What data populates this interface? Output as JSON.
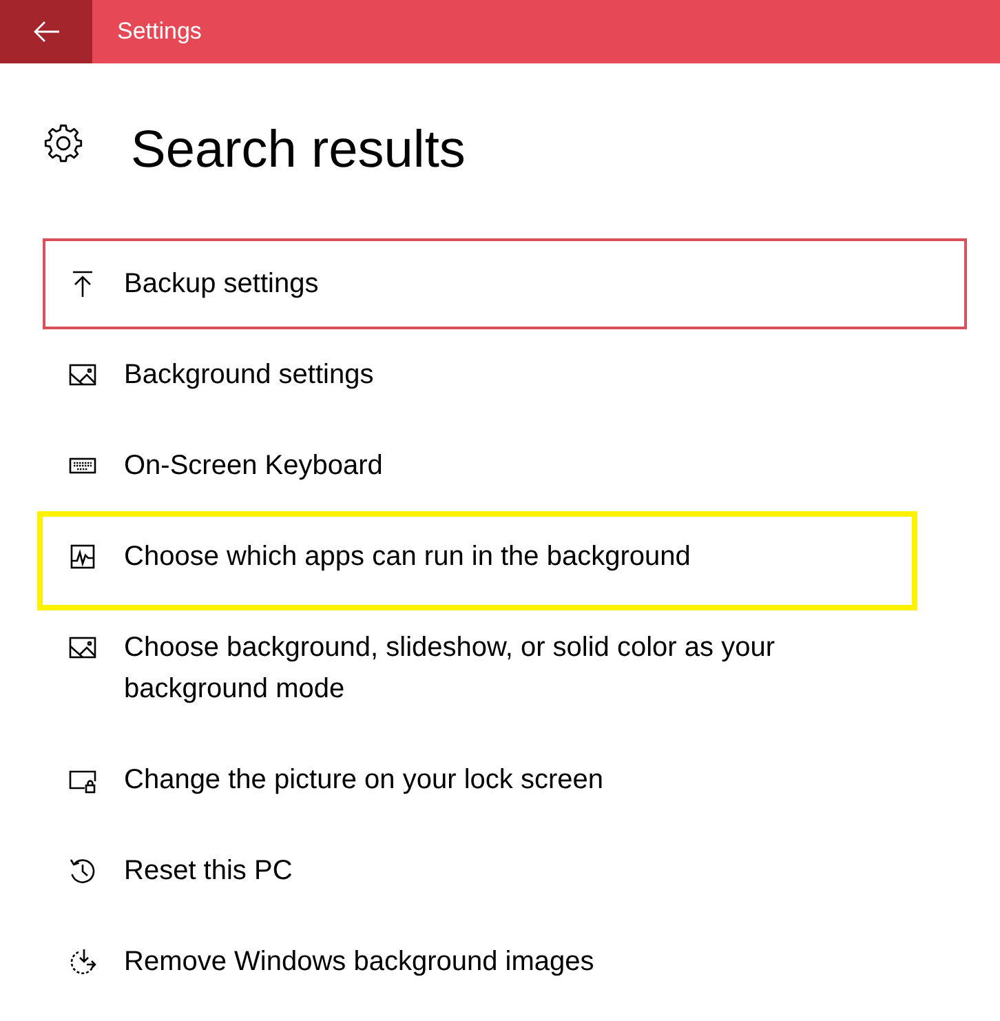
{
  "window": {
    "title": "Settings"
  },
  "page": {
    "title": "Search results"
  },
  "results": [
    {
      "kind": "upload",
      "label": "Backup settings",
      "selected": true,
      "highlighted": false
    },
    {
      "kind": "picture",
      "label": "Background settings",
      "selected": false,
      "highlighted": false
    },
    {
      "kind": "keyboard",
      "label": "On-Screen Keyboard",
      "selected": false,
      "highlighted": false
    },
    {
      "kind": "activity",
      "label": "Choose which apps can run in the background",
      "selected": false,
      "highlighted": true
    },
    {
      "kind": "picture",
      "label": "Choose background, slideshow, or solid color as your background mode",
      "selected": false,
      "highlighted": false
    },
    {
      "kind": "lockscreen",
      "label": "Change the picture on your lock screen",
      "selected": false,
      "highlighted": false
    },
    {
      "kind": "history",
      "label": "Reset this PC",
      "selected": false,
      "highlighted": false
    },
    {
      "kind": "restore",
      "label": "Remove Windows background images",
      "selected": false,
      "highlighted": false
    }
  ]
}
